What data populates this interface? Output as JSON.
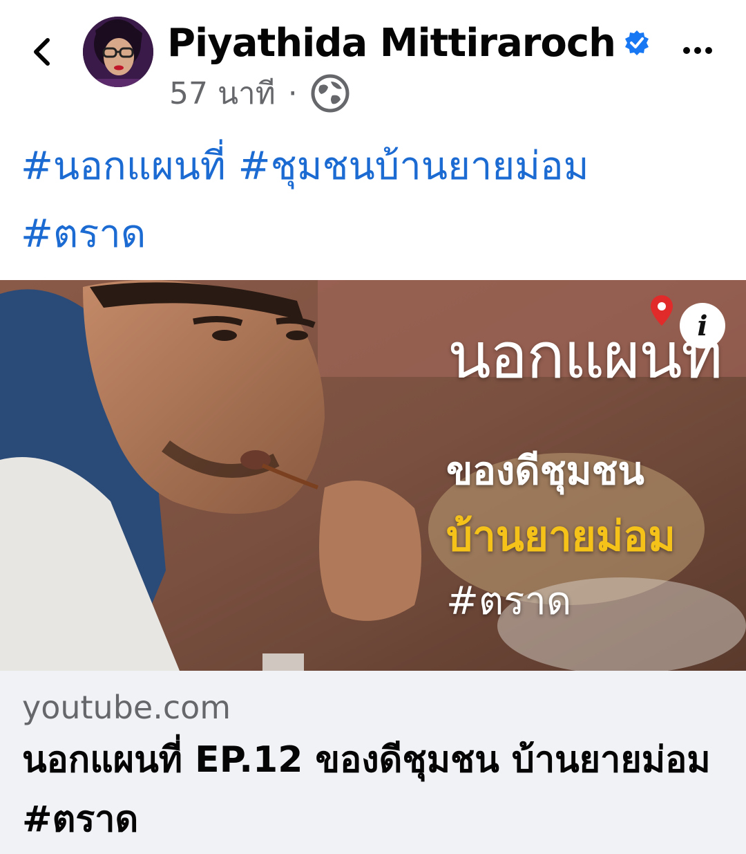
{
  "post": {
    "author_name": "Piyathida Mittiraroch",
    "timestamp": "57 นาที",
    "separator": "·",
    "privacy_icon": "globe-icon",
    "hashtags": [
      "#นอกแผนที่",
      "#ชุมชนบ้านยายม่อม",
      "#ตราด"
    ]
  },
  "media": {
    "overlay_title": "นอกแผนที่",
    "overlay_line1": "ของดีชุมชน",
    "overlay_line2": "บ้านยายม่อม",
    "overlay_line3": "#ตราด",
    "info_label": "i"
  },
  "link_preview": {
    "domain": "youtube.com",
    "title": "นอกแผนที่ EP.12 ของดีชุมชน บ้านยายม่อม #ตราด"
  },
  "colors": {
    "hashtag": "#1b6bd3",
    "verified": "#1877f2",
    "highlight_text": "#f5c21a",
    "card_bg": "#f1f2f5"
  },
  "icons": {
    "back": "chevron-left-icon",
    "more": "more-horizontal-icon",
    "verified": "verified-badge-icon",
    "pin": "map-pin-icon"
  }
}
